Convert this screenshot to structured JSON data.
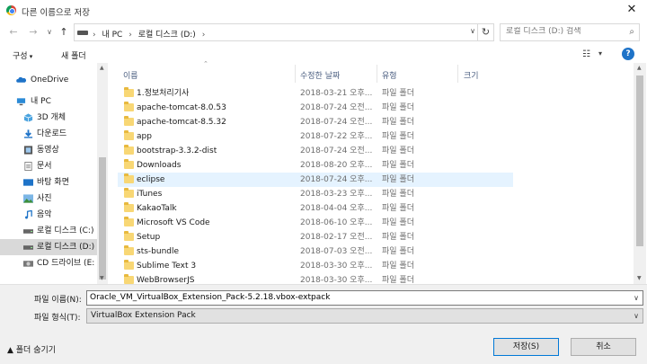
{
  "window": {
    "title": "다른 이름으로 저장",
    "close_glyph": "✕"
  },
  "nav": {
    "back_glyph": "←",
    "forward_glyph": "→",
    "recent_glyph": "∨",
    "up_glyph": "↑",
    "breadcrumb": [
      "내 PC",
      "로컬 디스크 (D:)"
    ],
    "crumb_separator": "›",
    "refresh_glyph": "↻",
    "search_placeholder": "로컬 디스크 (D:) 검색",
    "search_glyph": "⌕"
  },
  "toolbar": {
    "organize_label": "구성",
    "new_folder_label": "새 폴더",
    "view_glyph": "☷",
    "view_caret": "▾",
    "help_glyph": "?"
  },
  "sidebar": {
    "items": [
      {
        "label": "OneDrive",
        "icon": "cloud-icon"
      },
      {
        "label": "내 PC",
        "icon": "pc-icon"
      },
      {
        "label": "3D 개체",
        "icon": "3d-objects-icon"
      },
      {
        "label": "다운로드",
        "icon": "download-icon"
      },
      {
        "label": "동영상",
        "icon": "video-icon"
      },
      {
        "label": "문서",
        "icon": "document-icon"
      },
      {
        "label": "바탕 화면",
        "icon": "desktop-icon"
      },
      {
        "label": "사진",
        "icon": "pictures-icon"
      },
      {
        "label": "음악",
        "icon": "music-icon"
      },
      {
        "label": "로컬 디스크 (C:)",
        "icon": "drive-icon"
      },
      {
        "label": "로컬 디스크 (D:)",
        "icon": "drive-icon",
        "selected": true
      },
      {
        "label": "CD 드라이브 (E:",
        "icon": "cd-drive-icon"
      }
    ]
  },
  "columns": {
    "name": "이름",
    "modified": "수정한 날짜",
    "type": "유형",
    "size": "크기"
  },
  "files": [
    {
      "name": "1.정보처리기사",
      "modified": "2018-03-21 오후...",
      "type": "파일 폴더"
    },
    {
      "name": "apache-tomcat-8.0.53",
      "modified": "2018-07-24 오전...",
      "type": "파일 폴더"
    },
    {
      "name": "apache-tomcat-8.5.32",
      "modified": "2018-07-24 오전...",
      "type": "파일 폴더"
    },
    {
      "name": "app",
      "modified": "2018-07-22 오후...",
      "type": "파일 폴더"
    },
    {
      "name": "bootstrap-3.3.2-dist",
      "modified": "2018-07-24 오전...",
      "type": "파일 폴더"
    },
    {
      "name": "Downloads",
      "modified": "2018-08-20 오후...",
      "type": "파일 폴더"
    },
    {
      "name": "eclipse",
      "modified": "2018-07-24 오후...",
      "type": "파일 폴더",
      "hovered": true
    },
    {
      "name": "iTunes",
      "modified": "2018-03-23 오후...",
      "type": "파일 폴더"
    },
    {
      "name": "KakaoTalk",
      "modified": "2018-04-04 오후...",
      "type": "파일 폴더"
    },
    {
      "name": "Microsoft VS Code",
      "modified": "2018-06-10 오후...",
      "type": "파일 폴더"
    },
    {
      "name": "Setup",
      "modified": "2018-02-17 오전...",
      "type": "파일 폴더"
    },
    {
      "name": "sts-bundle",
      "modified": "2018-07-03 오전...",
      "type": "파일 폴더"
    },
    {
      "name": "Sublime Text 3",
      "modified": "2018-03-30 오후...",
      "type": "파일 폴더"
    },
    {
      "name": "WebBrowserJS",
      "modified": "2018-03-30 오후...",
      "type": "파일 폴더"
    }
  ],
  "bottom": {
    "filename_label": "파일 이름(N):",
    "filename_value": "Oracle_VM_VirtualBox_Extension_Pack-5.2.18.vbox-extpack",
    "filetype_label": "파일 형식(T):",
    "filetype_value": "VirtualBox Extension Pack",
    "dropdown_caret": "∨",
    "hide_folders_label": "▲  폴더 숨기기",
    "save_label": "저장(S)",
    "cancel_label": "취소"
  },
  "colors": {
    "accent": "#0078d7",
    "selection": "#d9d9d9",
    "hover": "#e5f3ff",
    "folder": "#f8d775"
  }
}
